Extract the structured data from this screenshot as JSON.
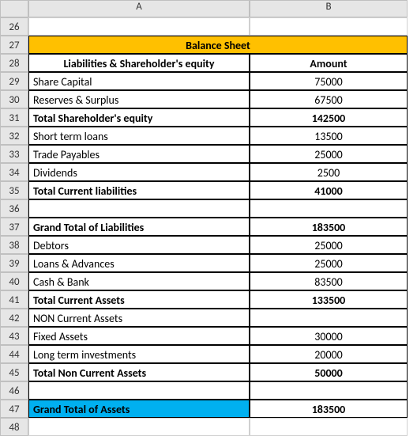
{
  "columns": {
    "A": "A",
    "B": "B"
  },
  "rownums": {
    "26": "26",
    "27": "27",
    "28": "28",
    "29": "29",
    "30": "30",
    "31": "31",
    "32": "32",
    "33": "33",
    "34": "34",
    "35": "35",
    "36": "36",
    "37": "37",
    "38": "38",
    "39": "39",
    "40": "40",
    "41": "41",
    "42": "42",
    "43": "43",
    "44": "44",
    "45": "45",
    "46": "46",
    "47": "47",
    "48": "48"
  },
  "title": "Balance Sheet",
  "headers": {
    "col_a": "Liabilities & Shareholder's equity",
    "col_b": "Amount"
  },
  "rows": {
    "share_capital": {
      "label": "Share Capital",
      "amount": "75000"
    },
    "reserves": {
      "label": "Reserves & Surplus",
      "amount": "67500"
    },
    "total_equity": {
      "label": "Total Shareholder's equity",
      "amount": "142500"
    },
    "short_term_loans": {
      "label": "Short term loans",
      "amount": "13500"
    },
    "trade_payables": {
      "label": "Trade Payables",
      "amount": "25000"
    },
    "dividends": {
      "label": "Dividends",
      "amount": "2500"
    },
    "total_current_liab": {
      "label": "Total Current liabilities",
      "amount": "41000"
    },
    "grand_total_liab": {
      "label": "Grand Total of Liabilities",
      "amount": "183500"
    },
    "debtors": {
      "label": "Debtors",
      "amount": "25000"
    },
    "loans_advances": {
      "label": "Loans & Advances",
      "amount": "25000"
    },
    "cash_bank": {
      "label": "Cash & Bank",
      "amount": "83500"
    },
    "total_current_assets": {
      "label": "Total Current Assets",
      "amount": "133500"
    },
    "non_current_header": {
      "label": "NON Current Assets",
      "amount": ""
    },
    "fixed_assets": {
      "label": "Fixed Assets",
      "amount": "30000"
    },
    "long_term_inv": {
      "label": "Long term investments",
      "amount": "20000"
    },
    "total_non_current": {
      "label": "Total Non Current Assets",
      "amount": "50000"
    },
    "grand_total_assets": {
      "label": "Grand Total of Assets",
      "amount": "183500"
    }
  },
  "chart_data": {
    "type": "table",
    "title": "Balance Sheet",
    "columns": [
      "Liabilities & Shareholder's equity",
      "Amount"
    ],
    "rows": [
      [
        "Share Capital",
        75000
      ],
      [
        "Reserves & Surplus",
        67500
      ],
      [
        "Total Shareholder's equity",
        142500
      ],
      [
        "Short term loans",
        13500
      ],
      [
        "Trade Payables",
        25000
      ],
      [
        "Dividends",
        2500
      ],
      [
        "Total Current liabilities",
        41000
      ],
      [
        "Grand Total of Liabilities",
        183500
      ],
      [
        "Debtors",
        25000
      ],
      [
        "Loans & Advances",
        25000
      ],
      [
        "Cash & Bank",
        83500
      ],
      [
        "Total Current Assets",
        133500
      ],
      [
        "NON Current Assets",
        null
      ],
      [
        "Fixed Assets",
        30000
      ],
      [
        "Long term investments",
        20000
      ],
      [
        "Total Non Current Assets",
        50000
      ],
      [
        "Grand Total of Assets",
        183500
      ]
    ]
  }
}
